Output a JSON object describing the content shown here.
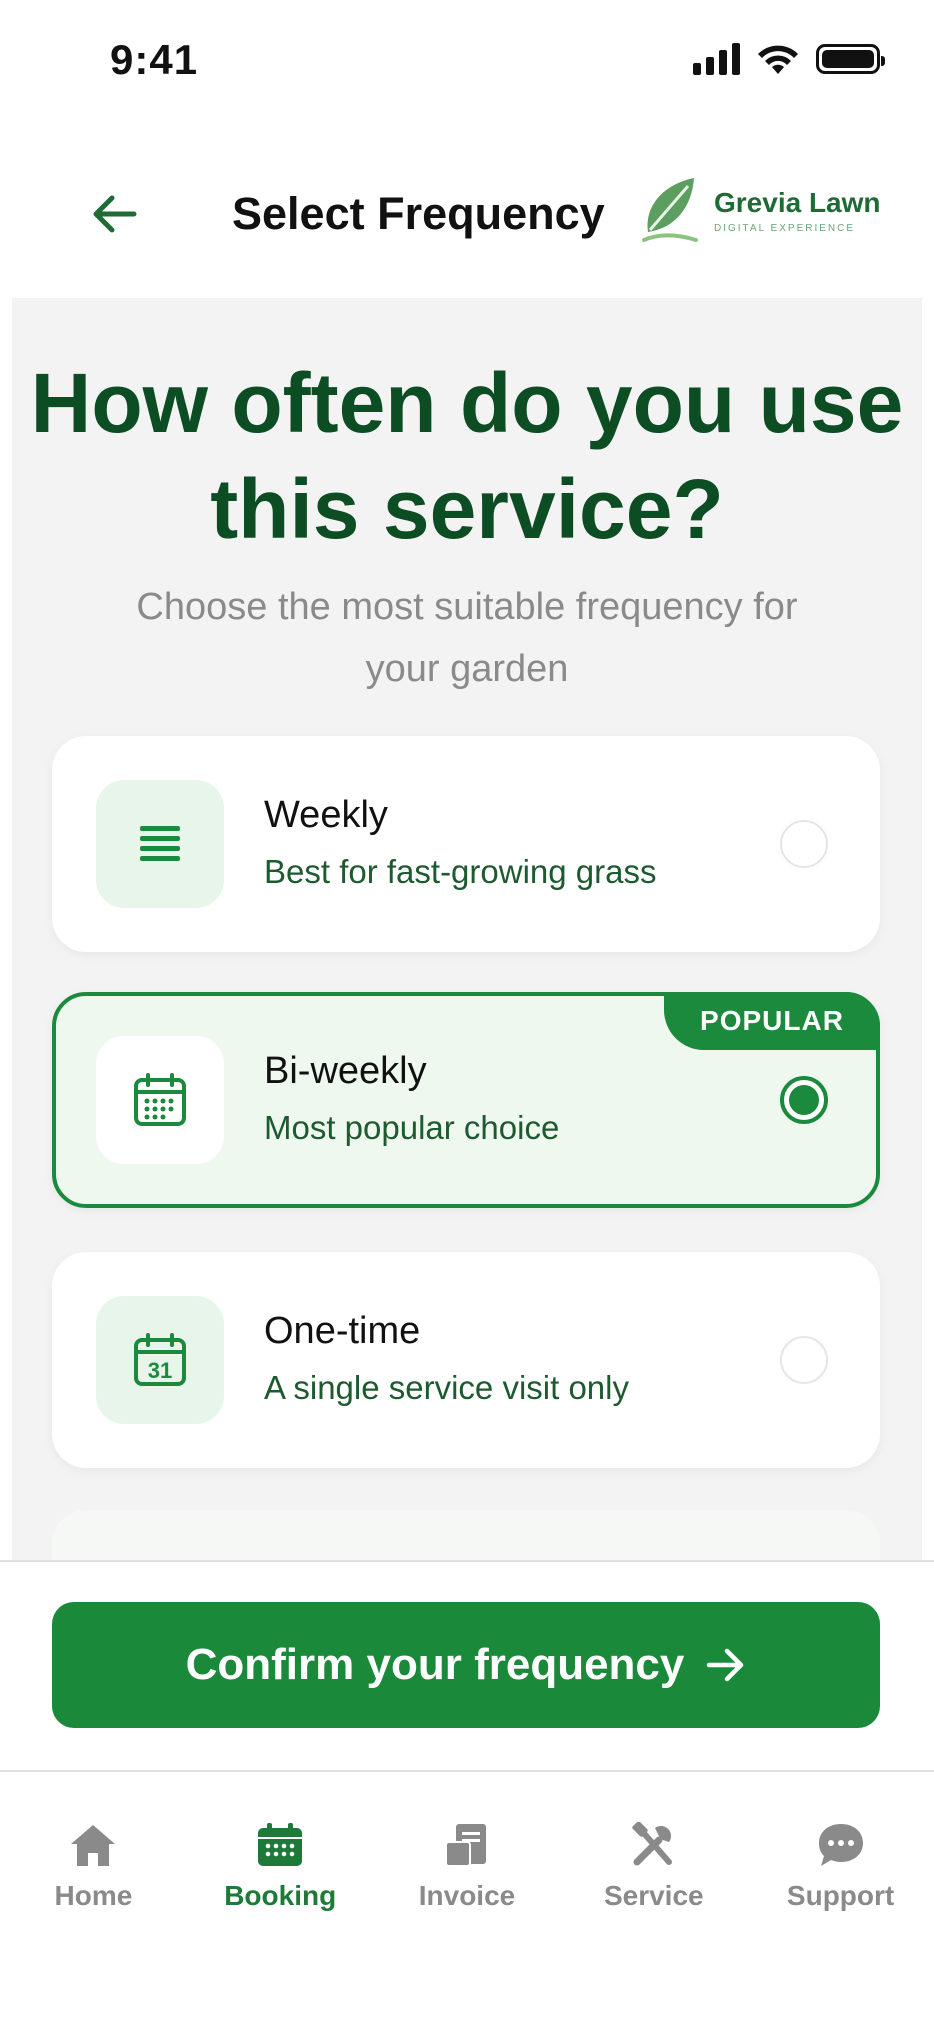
{
  "status_bar": {
    "time": "9:41"
  },
  "header": {
    "title": "Select Frequency",
    "brand_name": "Grevia Lawn",
    "brand_tagline": "DIGITAL EXPERIENCE"
  },
  "hero": {
    "headline": "How often do you use this service?",
    "subtitle": "Choose the most suitable frequency for your garden"
  },
  "options": [
    {
      "title": "Weekly",
      "description": "Best for fast-growing grass",
      "icon": "list-icon",
      "selected": false
    },
    {
      "title": "Bi-weekly",
      "description": "Most popular choice",
      "icon": "calendar-grid-icon",
      "selected": true,
      "badge": "POPULAR"
    },
    {
      "title": "One-time",
      "description": "A single service visit only",
      "icon": "calendar-31-icon",
      "selected": false,
      "icon_text": "31"
    }
  ],
  "confirm_button": {
    "label": "Confirm your frequency"
  },
  "tabs": [
    {
      "label": "Home",
      "icon": "home-icon",
      "active": false
    },
    {
      "label": "Booking",
      "icon": "calendar-icon",
      "active": true
    },
    {
      "label": "Invoice",
      "icon": "invoice-icon",
      "active": false
    },
    {
      "label": "Service",
      "icon": "tools-icon",
      "active": false
    },
    {
      "label": "Support",
      "icon": "chat-icon",
      "active": false
    }
  ],
  "colors": {
    "primary": "#1a8a3a",
    "headline": "#0d4d24",
    "selected_bg": "#eef8ef",
    "inactive_tab": "#8a8a8a"
  }
}
